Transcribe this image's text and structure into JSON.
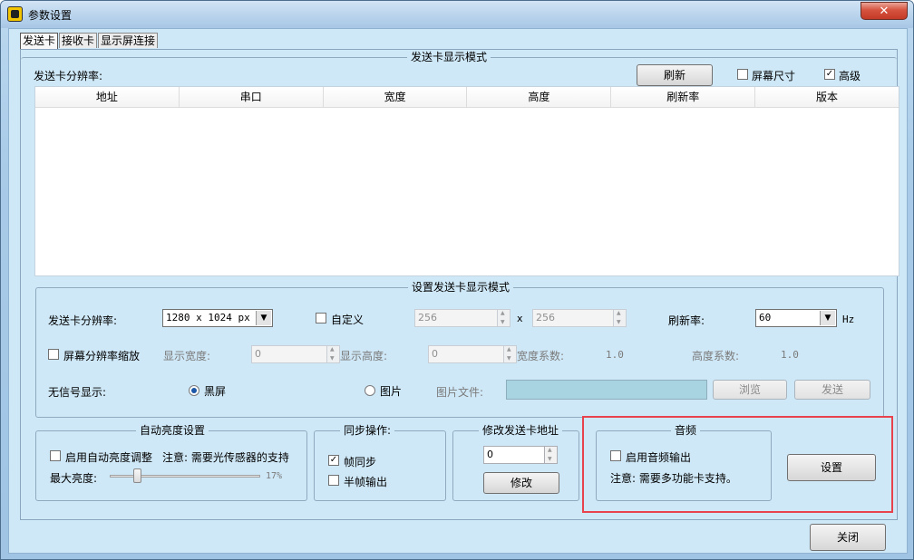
{
  "window": {
    "title": "参数设置",
    "close_glyph": "✕"
  },
  "tabs": [
    {
      "label": "发送卡"
    },
    {
      "label": "接收卡"
    },
    {
      "label": "显示屏连接"
    }
  ],
  "display_mode": {
    "legend": "发送卡显示模式",
    "resolution_label": "发送卡分辨率:",
    "refresh_button": "刷新",
    "screen_size_label": "屏幕尺寸",
    "screen_size_checked": false,
    "advanced_label": "高级",
    "advanced_checked": true,
    "columns": [
      "地址",
      "串口",
      "宽度",
      "高度",
      "刷新率",
      "版本"
    ]
  },
  "set_mode": {
    "legend": "设置发送卡显示模式",
    "resolution_label": "发送卡分辨率:",
    "resolution_value": "1280 x 1024 px",
    "custom_label": "自定义",
    "custom_checked": false,
    "width_value": "256",
    "x_separator": "x",
    "height_value": "256",
    "refresh_label": "刷新率:",
    "refresh_value": "60",
    "hz_unit": "Hz",
    "scale_label": "屏幕分辨率缩放",
    "scale_checked": false,
    "display_width_label": "显示宽度:",
    "display_width_value": "0",
    "display_height_label": "显示高度:",
    "display_height_value": "0",
    "width_coef_label": "宽度系数:",
    "width_coef_value": "1.0",
    "height_coef_label": "高度系数:",
    "height_coef_value": "1.0",
    "no_signal_label": "无信号显示:",
    "black_screen_label": "黑屏",
    "black_screen_selected": true,
    "picture_label": "图片",
    "picture_selected": false,
    "picture_file_label": "图片文件:",
    "picture_file_value": "",
    "browse_button": "浏览",
    "send_button": "发送"
  },
  "auto_brightness": {
    "legend": "自动亮度设置",
    "enable_label": "启用自动亮度调整",
    "enable_checked": false,
    "note": "注意: 需要光传感器的支持",
    "max_label": "最大亮度:",
    "max_percent_label": "17%",
    "max_percent": 17
  },
  "sync": {
    "legend": "同步操作:",
    "frame_sync_label": "帧同步",
    "frame_sync_checked": true,
    "half_frame_label": "半帧输出",
    "half_frame_checked": false
  },
  "address": {
    "legend": "修改发送卡地址",
    "value": "0",
    "modify_button": "修改"
  },
  "audio": {
    "legend": "音频",
    "enable_label": "启用音频输出",
    "enable_checked": false,
    "note": "注意: 需要多功能卡支持。",
    "settings_button": "设置",
    "highlight_color": "#e8424d"
  },
  "footer": {
    "close_button": "关闭"
  }
}
